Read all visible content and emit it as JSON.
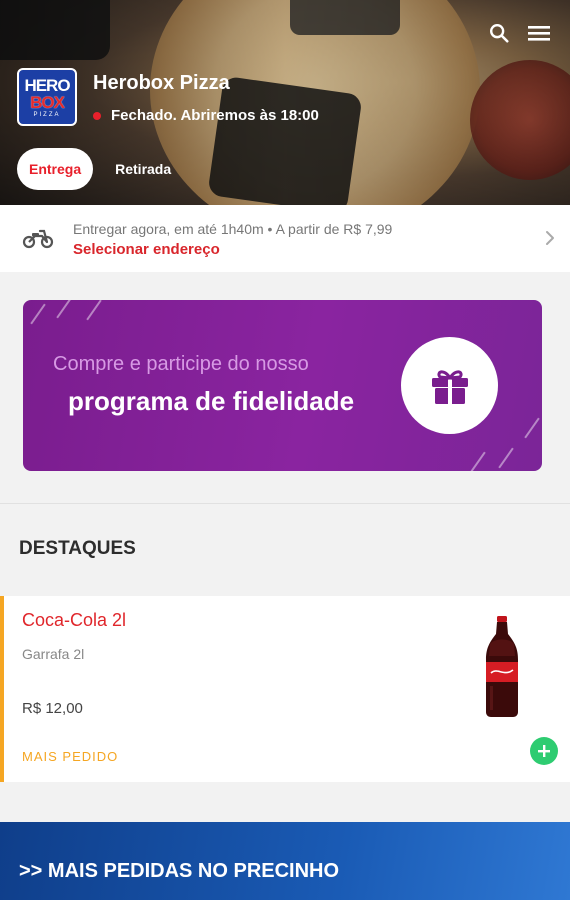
{
  "header": {
    "store_name": "Herobox Pizza",
    "status_text": "Fechado. Abriremos às 18:00",
    "status_color": "#e8202b",
    "logo": {
      "line1": "HERO",
      "line2": "BOX",
      "line3": "PIZZA"
    },
    "icons": [
      "search-icon",
      "menu-icon"
    ]
  },
  "modes": {
    "delivery": "Entrega",
    "pickup": "Retirada",
    "selected": "Entrega"
  },
  "delivery": {
    "line1": "Entregar agora, em até 1h40m • A partir de R$ 7,99",
    "select_address": "Selecionar endereço",
    "icon": "motorcycle-icon"
  },
  "loyalty": {
    "line1": "Compre e participe do nosso",
    "line2": "programa de fidelidade",
    "icon": "gift-icon"
  },
  "highlights": {
    "title": "DESTAQUES",
    "products": [
      {
        "name": "Coca-Cola 2l",
        "description": "Garrafa 2l",
        "price": "R$ 12,00",
        "tag": "MAIS PEDIDO"
      }
    ]
  },
  "promo_banner": {
    "text": ">> MAIS PEDIDAS NO PRECINHO"
  },
  "colors": {
    "accent": "#e0262b",
    "loyalty_purple": "#8a24a0",
    "add_green": "#2ecc71",
    "tag_orange": "#f5a623"
  }
}
